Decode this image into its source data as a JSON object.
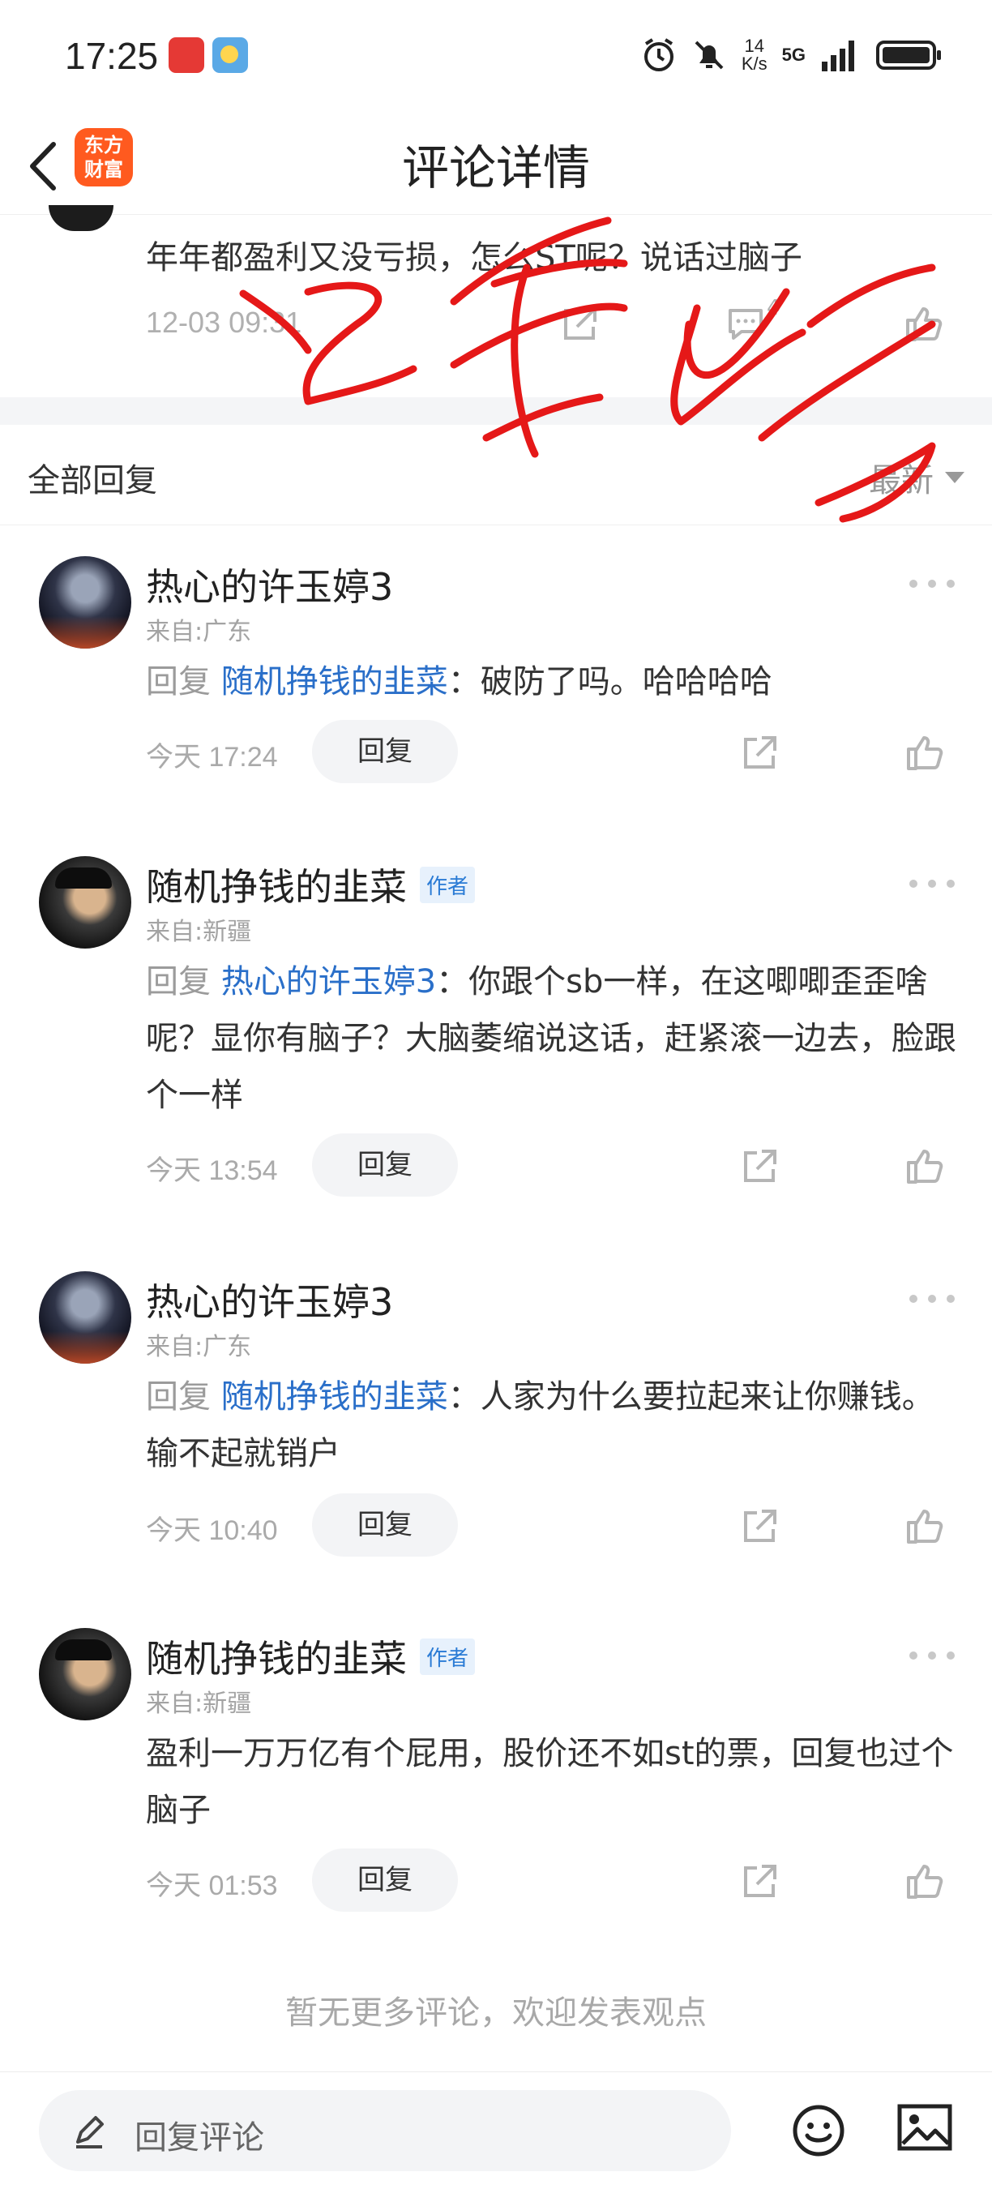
{
  "status_bar": {
    "time": "17:25",
    "speed_value": "14",
    "speed_unit": "K/s",
    "network": "5G",
    "icons": [
      "alarm-icon",
      "mute-icon",
      "signal-icon",
      "battery-icon"
    ]
  },
  "header": {
    "title": "评论详情",
    "logo_line1": "东方",
    "logo_line2": "财富"
  },
  "original_comment": {
    "text": "年年都盈利又没亏损，怎么ST呢？说话过脑子",
    "date": "12-03 09:31",
    "comment_count": "4"
  },
  "replies_header": {
    "label": "全部回复",
    "sort": "最新"
  },
  "replies": [
    {
      "name": "热心的许玉婷3",
      "author_badge": "",
      "from": "来自:广东",
      "reply_prefix": "回复",
      "reply_to": "随机挣钱的韭菜",
      "text": "：破防了吗。哈哈哈哈",
      "time": "今天 17:24",
      "reply_btn": "回复"
    },
    {
      "name": "随机挣钱的韭菜",
      "author_badge": "作者",
      "from": "来自:新疆",
      "reply_prefix": "回复",
      "reply_to": "热心的许玉婷3",
      "text": "：你跟个sb一样，在这唧唧歪歪啥呢？显你有脑子？大脑萎缩说这话，赶紧滚一边去，脸跟个一样",
      "time": "今天 13:54",
      "reply_btn": "回复"
    },
    {
      "name": "热心的许玉婷3",
      "author_badge": "",
      "from": "来自:广东",
      "reply_prefix": "回复",
      "reply_to": "随机挣钱的韭菜",
      "text": "：人家为什么要拉起来让你赚钱。输不起就销户",
      "time": "今天 10:40",
      "reply_btn": "回复"
    },
    {
      "name": "随机挣钱的韭菜",
      "author_badge": "作者",
      "from": "来自:新疆",
      "reply_prefix": "",
      "reply_to": "",
      "text": "盈利一万万亿有个屁用，股价还不如st的票，回复也过个脑子",
      "time": "今天 01:53",
      "reply_btn": "回复"
    }
  ],
  "footer_note": "暂无更多评论，欢迎发表观点",
  "bottom_bar": {
    "input_placeholder": "回复评论"
  }
}
